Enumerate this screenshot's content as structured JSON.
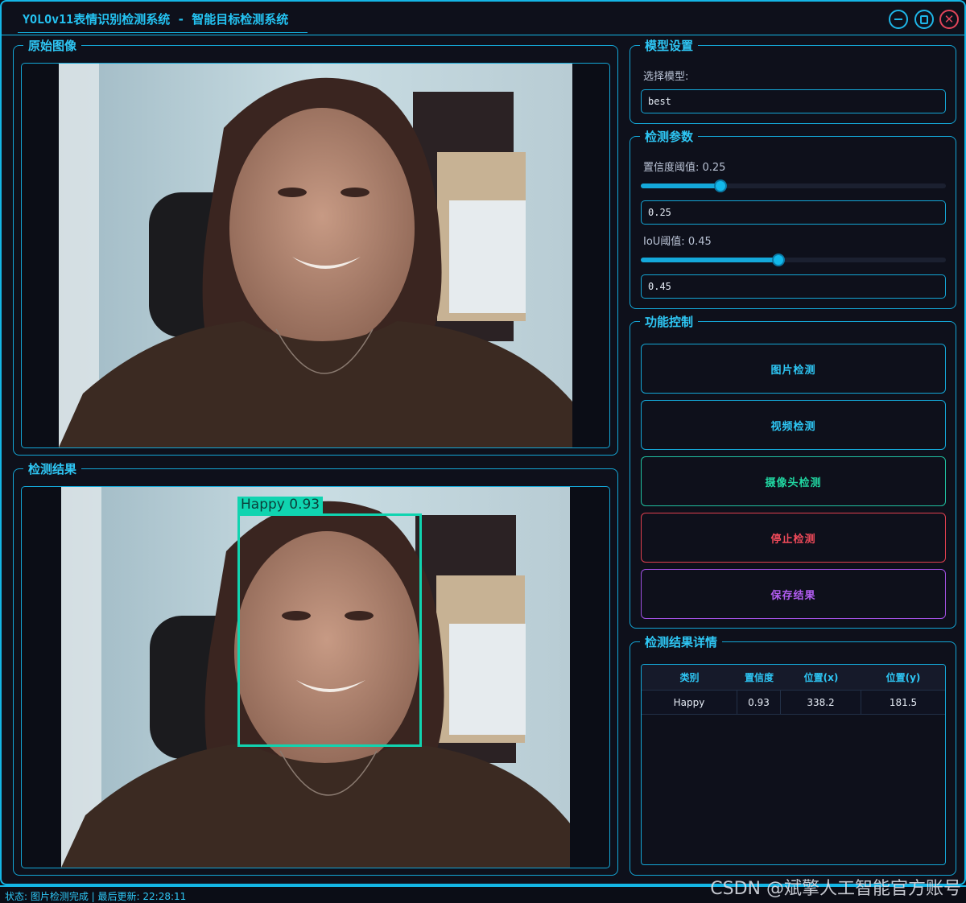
{
  "window": {
    "title": "YOLOv11表情识别检测系统 - 智能目标检测系统"
  },
  "panels": {
    "original_title": "原始图像",
    "result_title": "检测结果",
    "model_title": "模型设置",
    "params_title": "检测参数",
    "control_title": "功能控制",
    "details_title": "检测结果详情"
  },
  "model": {
    "select_label": "选择模型:",
    "selected": "best"
  },
  "params": {
    "conf_label": "置信度阈值: 0.25",
    "conf_value": "0.25",
    "conf_fraction": 0.26,
    "iou_label": "IoU阈值: 0.45",
    "iou_value": "0.45",
    "iou_fraction": 0.45
  },
  "buttons": {
    "image_detect": "图片检测",
    "video_detect": "视频检测",
    "camera_detect": "摄像头检测",
    "stop_detect": "停止检测",
    "save_result": "保存结果"
  },
  "colors": {
    "accent": "#14b6e6",
    "image_btn": "#2ec7f5",
    "video_btn": "#2ec7f5",
    "camera_btn": "#20d4a0",
    "stop_btn": "#f04a5a",
    "save_btn": "#b15cf0",
    "detect_box": "#10d4b0"
  },
  "detection": {
    "label": "Happy 0.93"
  },
  "table": {
    "headers": [
      "类别",
      "置信度",
      "位置(x)",
      "位置(y)"
    ],
    "rows": [
      [
        "Happy",
        "0.93",
        "338.2",
        "181.5"
      ]
    ]
  },
  "status": {
    "text": "状态: 图片检测完成 | 最后更新: 22:28:11"
  },
  "watermark": "CSDN @斌擎人工智能官方账号"
}
